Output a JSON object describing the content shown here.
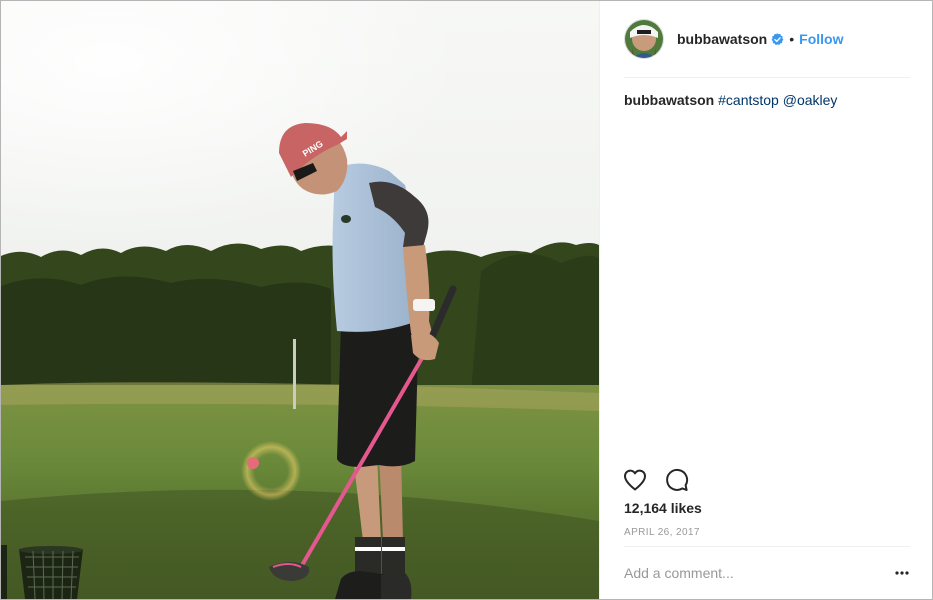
{
  "post": {
    "username": "bubbawatson",
    "verified": true,
    "separator": "•",
    "follow_label": "Follow",
    "caption": {
      "username": "bubbawatson",
      "hashtag": "#cantstop",
      "mention": "@oakley"
    },
    "likes": "12,164 likes",
    "date": "APRIL 26, 2017",
    "comment_placeholder": "Add a comment...",
    "photo_subject": "golfer on driving range at sunset with pink driver",
    "cap_logo": "PING"
  },
  "icons": {
    "verified": "verified-badge-icon",
    "like": "heart-icon",
    "comment": "comment-bubble-icon",
    "more": "more-options-icon"
  },
  "colors": {
    "link_blue": "#3897f0",
    "tag_navy": "#003569",
    "muted_gray": "#999999",
    "text": "#262626"
  }
}
